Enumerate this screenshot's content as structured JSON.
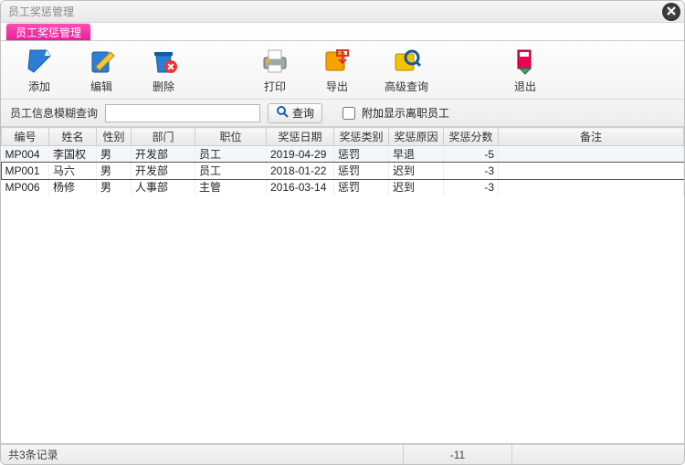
{
  "window": {
    "title": "员工奖惩管理"
  },
  "tab": {
    "label": "员工奖惩管理"
  },
  "toolbar": {
    "add": "添加",
    "edit": "编辑",
    "delete": "删除",
    "print": "打印",
    "export": "导出",
    "adv_search": "高级查询",
    "exit": "退出"
  },
  "search": {
    "label": "员工信息模糊查询",
    "value": "",
    "button": "查询",
    "include_leaver_label": "附加显示离职员工",
    "include_leaver_checked": false
  },
  "columns": {
    "id": "编号",
    "name": "姓名",
    "gender": "性别",
    "dept": "部门",
    "pos": "职位",
    "date": "奖惩日期",
    "type": "奖惩类别",
    "reason": "奖惩原因",
    "score": "奖惩分数",
    "remark": "备注"
  },
  "rows": [
    {
      "id": "MP004",
      "name": "李国权",
      "gender": "男",
      "dept": "开发部",
      "pos": "员工",
      "date": "2019-04-29",
      "type": "惩罚",
      "reason": "早退",
      "score": "-5",
      "remark": ""
    },
    {
      "id": "MP001",
      "name": "马六",
      "gender": "男",
      "dept": "开发部",
      "pos": "员工",
      "date": "2018-01-22",
      "type": "惩罚",
      "reason": "迟到",
      "score": "-3",
      "remark": ""
    },
    {
      "id": "MP006",
      "name": "杨修",
      "gender": "男",
      "dept": "人事部",
      "pos": "主管",
      "date": "2016-03-14",
      "type": "惩罚",
      "reason": "迟到",
      "score": "-3",
      "remark": ""
    }
  ],
  "status": {
    "count_text": "共3条记录",
    "sum_text": "-11"
  }
}
